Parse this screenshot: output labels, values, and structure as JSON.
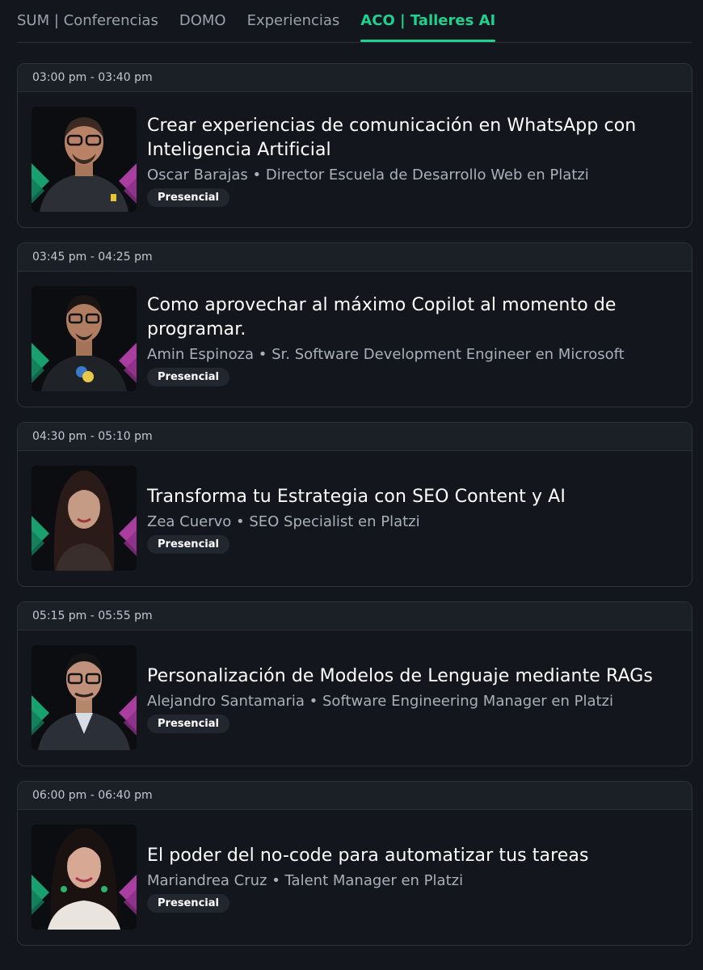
{
  "tabs": [
    {
      "label": "SUM | Conferencias",
      "active": false
    },
    {
      "label": "DOMO",
      "active": false
    },
    {
      "label": "Experiencias",
      "active": false
    },
    {
      "label": "ACO | Talleres AI",
      "active": true
    }
  ],
  "colors": {
    "accent": "#1fd18f",
    "background": "#13161c",
    "card_header": "#1b1f26"
  },
  "sessions": [
    {
      "time": "03:00 pm - 03:40 pm",
      "title": "Crear experiencias de comunicación en WhatsApp con Inteligencia Artificial",
      "speaker": "Oscar Barajas • Director Escuela de Desarrollo Web en Platzi",
      "badge": "Presencial"
    },
    {
      "time": "03:45 pm - 04:25 pm",
      "title": "Como aprovechar al máximo Copilot al momento de programar.",
      "speaker": "Amin Espinoza • Sr. Software Development Engineer en Microsoft",
      "badge": "Presencial"
    },
    {
      "time": "04:30 pm - 05:10 pm",
      "title": "Transforma tu Estrategia con SEO Content y AI",
      "speaker": "Zea Cuervo • SEO Specialist en Platzi",
      "badge": "Presencial"
    },
    {
      "time": "05:15 pm - 05:55 pm",
      "title": "Personalización de Modelos de Lenguaje mediante RAGs",
      "speaker": "Alejandro Santamaria • Software Engineering Manager en Platzi",
      "badge": "Presencial"
    },
    {
      "time": "06:00 pm - 06:40 pm",
      "title": "El poder del no-code para automatizar tus tareas",
      "speaker": "Mariandrea Cruz • Talent Manager en Platzi",
      "badge": "Presencial"
    }
  ]
}
